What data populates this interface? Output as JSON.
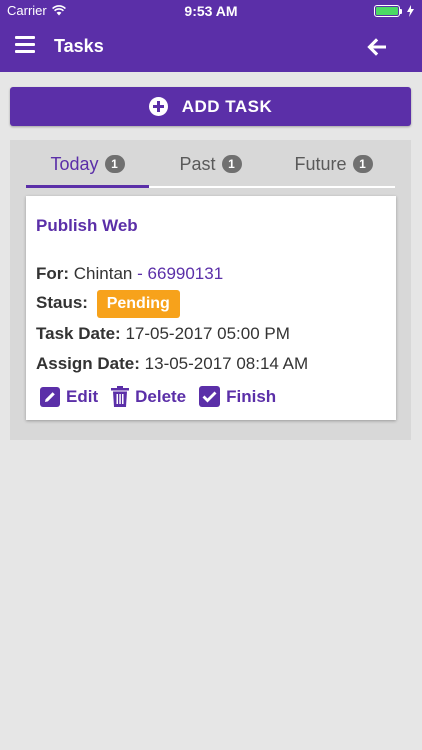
{
  "status_bar": {
    "carrier": "Carrier",
    "time": "9:53 AM",
    "battery_percent": 100
  },
  "header": {
    "title": "Tasks"
  },
  "add_task": {
    "label": "ADD TASK"
  },
  "tabs": [
    {
      "label": "Today",
      "count": "1"
    },
    {
      "label": "Past",
      "count": "1"
    },
    {
      "label": "Future",
      "count": "1"
    }
  ],
  "task": {
    "title": "Publish Web",
    "for_label": "For:",
    "for_name": "Chintan",
    "for_separator": "-",
    "for_phone": "66990131",
    "status_label": "Staus:",
    "status_value": "Pending",
    "task_date_label": "Task Date:",
    "task_date": "17-05-2017 05:00 PM",
    "assign_date_label": "Assign Date:",
    "assign_date": "13-05-2017 08:14 AM",
    "actions": {
      "edit": "Edit",
      "delete": "Delete",
      "finish": "Finish"
    }
  },
  "colors": {
    "primary": "#5b2fa8",
    "pending": "#f7a21b",
    "badge": "#707070",
    "background": "#e6e6e6"
  }
}
